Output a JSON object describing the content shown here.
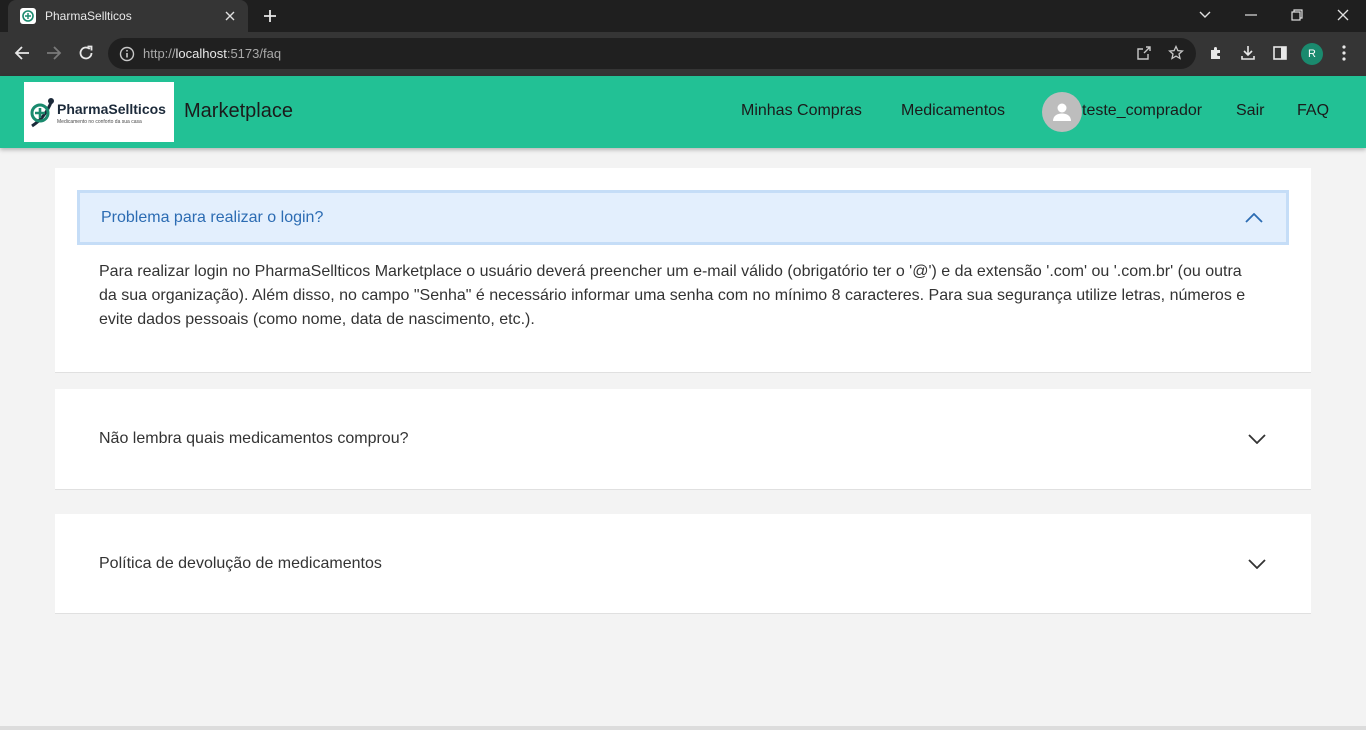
{
  "browser": {
    "tab_title": "PharmaSellticos",
    "url_prefix": "http://",
    "url_host": "localhost",
    "url_path": ":5173/faq",
    "profile_initial": "R"
  },
  "app": {
    "brand_name": "PharmaSellticos",
    "brand_tagline": "Medicamento no conforto da sua casa",
    "title": "Marketplace",
    "accent_color": "#22c195",
    "nav": {
      "purchases": "Minhas Compras",
      "medicines": "Medicamentos",
      "username": "teste_comprador",
      "logout": "Sair",
      "faq": "FAQ"
    }
  },
  "faq": {
    "items": [
      {
        "question": "Problema para realizar o login?",
        "answer": "Para realizar login no PharmaSellticos Marketplace o usuário deverá preencher um e-mail válido (obrigatório ter o '@') e da extensão '.com' ou '.com.br' (ou outra da sua organização). Além disso, no campo \"Senha\" é necessário informar uma senha com no mínimo 8 caracteres. Para sua segurança utilize letras, números e evite dados pessoais (como nome, data de nascimento, etc.).",
        "expanded": true
      },
      {
        "question": "Não lembra quais medicamentos comprou?",
        "expanded": false
      },
      {
        "question": "Política de devolução de medicamentos",
        "expanded": false
      }
    ]
  }
}
